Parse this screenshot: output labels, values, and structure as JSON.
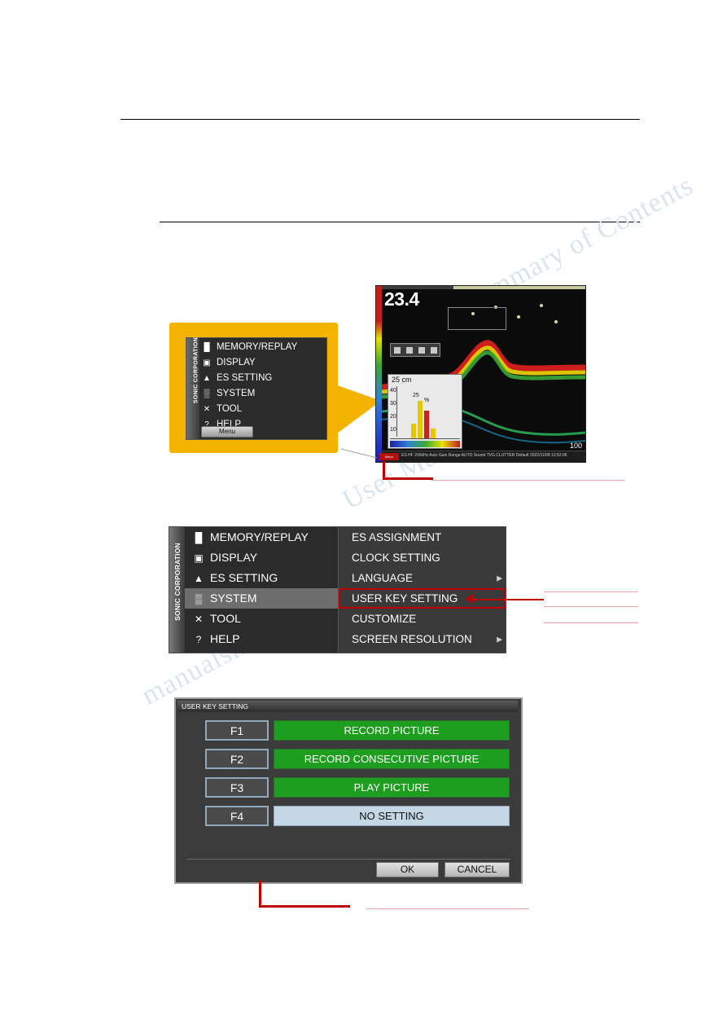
{
  "watermarks": [
    "Summary of Contents",
    "User Manual",
    "manualshive.com"
  ],
  "callout_menu": {
    "sidebar_label": "SONIC CORPORATION",
    "items": [
      {
        "icon": "folder-icon",
        "glyph": "█",
        "label": "MEMORY/REPLAY"
      },
      {
        "icon": "display-icon",
        "glyph": "▣",
        "label": "DISPLAY"
      },
      {
        "icon": "fish-icon",
        "glyph": "▲",
        "label": "ES SETTING"
      },
      {
        "icon": "system-icon",
        "glyph": "▒",
        "label": "SYSTEM"
      },
      {
        "icon": "tool-icon",
        "glyph": "✕",
        "label": "TOOL"
      },
      {
        "icon": "help-icon",
        "glyph": "?",
        "label": "HELP"
      }
    ],
    "menu_button": "Menu"
  },
  "sonar": {
    "depth_value": "23.4",
    "histogram_title": "25 cm",
    "histogram_peak_label": "25",
    "histogram_sub_label": "%",
    "axis_labels": [
      "40",
      "30",
      "20",
      "10"
    ],
    "right_scale": "100",
    "status_bar": "ES  HF  200kHz   Auto  Gain   Range  AUTO  Sound  TVG   CLUTTER  Default                    2022/11/08  13:52:06",
    "tag_label": "Menu"
  },
  "expanded_menu": {
    "sidebar_label": "SONIC CORPORATION",
    "left_items": [
      {
        "icon": "folder-icon",
        "glyph": "█",
        "label": "MEMORY/REPLAY",
        "selected": false
      },
      {
        "icon": "display-icon",
        "glyph": "▣",
        "label": "DISPLAY",
        "selected": false
      },
      {
        "icon": "fish-icon",
        "glyph": "▲",
        "label": "ES SETTING",
        "selected": false
      },
      {
        "icon": "system-icon",
        "glyph": "▒",
        "label": "SYSTEM",
        "selected": true
      },
      {
        "icon": "tool-icon",
        "glyph": "✕",
        "label": "TOOL",
        "selected": false
      },
      {
        "icon": "help-icon",
        "glyph": "?",
        "label": "HELP",
        "selected": false
      }
    ],
    "right_items": [
      {
        "label": "ES ASSIGNMENT",
        "arrow": false,
        "highlighted": false
      },
      {
        "label": "CLOCK SETTING",
        "arrow": false,
        "highlighted": false
      },
      {
        "label": "LANGUAGE",
        "arrow": true,
        "highlighted": false
      },
      {
        "label": "USER KEY SETTING",
        "arrow": false,
        "highlighted": true
      },
      {
        "label": "CUSTOMIZE",
        "arrow": false,
        "highlighted": false
      },
      {
        "label": "SCREEN RESOLUTION",
        "arrow": true,
        "highlighted": false
      }
    ]
  },
  "dialog": {
    "title": "USER KEY SETTING",
    "rows": [
      {
        "key": "F1",
        "value": "RECORD PICTURE",
        "state": "set"
      },
      {
        "key": "F2",
        "value": "RECORD CONSECUTIVE PICTURE",
        "state": "set"
      },
      {
        "key": "F3",
        "value": "PLAY PICTURE",
        "state": "set"
      },
      {
        "key": "F4",
        "value": "NO SETTING",
        "state": "unset"
      }
    ],
    "ok_label": "OK",
    "cancel_label": "CANCEL"
  }
}
